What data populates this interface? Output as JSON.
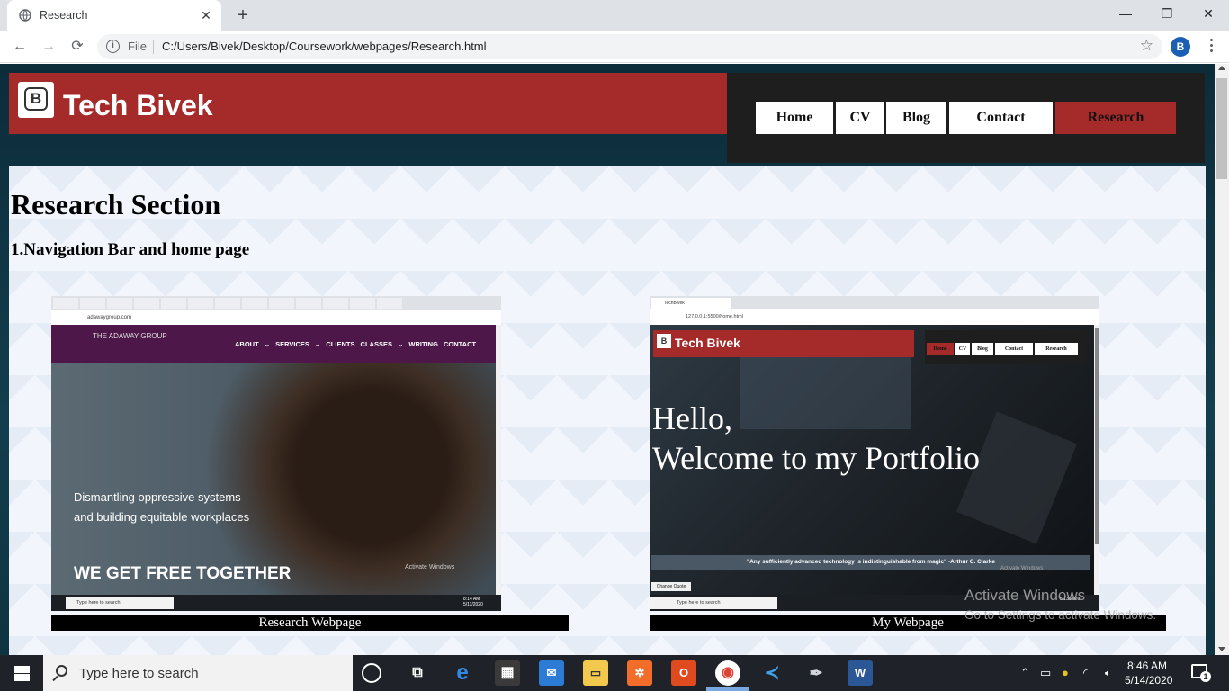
{
  "browser": {
    "tab_title": "Research",
    "url_scheme": "File",
    "url": "C:/Users/Bivek/Desktop/Coursework/webpages/Research.html",
    "profile_initial": "B"
  },
  "site": {
    "brand": "Tech Bivek",
    "logo_letter": "B",
    "nav": [
      "Home",
      "CV",
      "Blog",
      "Contact",
      "Research"
    ],
    "active_nav": "Research",
    "heading": "Research Section",
    "subheading": "1.Navigation Bar and home page"
  },
  "screenshots": {
    "left": {
      "caption": "Research Webpage",
      "url": "adawaygroup.com",
      "logo": "THE ADAWAY GROUP",
      "links": "ABOUT ⌄ SERVICES ⌄ CLIENTS CLASSES ⌄ WRITING CONTACT",
      "line1": "Dismantling oppressive systems",
      "line2": "and building equitable workplaces",
      "tagline": "WE GET FREE TOGETHER",
      "watermark": "Activate Windows",
      "search": "Type here to search",
      "time": "8:14 AM",
      "date": "5/11/2020"
    },
    "right": {
      "caption": "My Webpage",
      "tab": "TechBivek",
      "url": "127.0.0.1:5500/home.html",
      "brand": "Tech Bivek",
      "logo_letter": "B",
      "nav": [
        "Home",
        "CV",
        "Blog",
        "Contact",
        "Research"
      ],
      "hello1": "Hello,",
      "hello2": "Welcome to my Portfolio",
      "quote": "\"Any sufficiently advanced technology is indistinguishable from magic\" -Arthur C. Clarke",
      "watermark": "Activate Windows",
      "change_quote": "Change Quote",
      "search": "Type here to search",
      "date": "5/13/2020"
    }
  },
  "watermark": {
    "title": "Activate Windows",
    "subtitle": "Go to Settings to activate Windows."
  },
  "taskbar": {
    "search_placeholder": "Type here to search",
    "time": "8:46 AM",
    "date": "5/14/2020",
    "notification_count": "1"
  },
  "colors": {
    "brand_red": "#a52a2a",
    "nav_dark": "#1e1e1e"
  }
}
